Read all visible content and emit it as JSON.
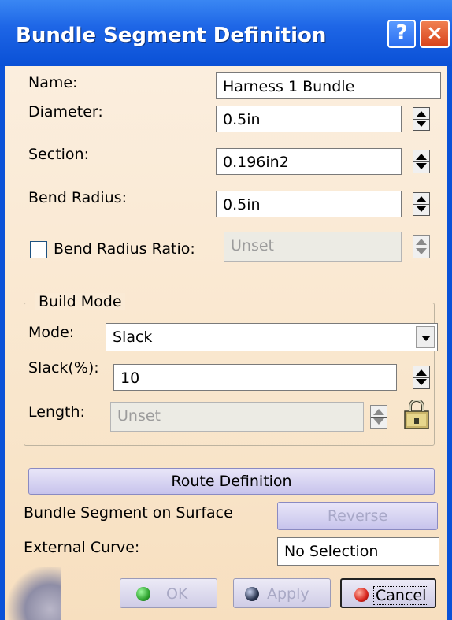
{
  "window": {
    "title": "Bundle Segment Definition",
    "help_label": "?",
    "close_label": "×"
  },
  "fields": {
    "name": {
      "label": "Name:",
      "value": "Harness 1 Bundle"
    },
    "diameter": {
      "label": "Diameter:",
      "value": "0.5in"
    },
    "section": {
      "label": "Section:",
      "value": "0.196in2"
    },
    "bend_radius": {
      "label": "Bend Radius:",
      "value": "0.5in"
    },
    "bend_radius_ratio": {
      "label": "Bend Radius Ratio:",
      "value": "Unset",
      "checked": false
    }
  },
  "build_mode": {
    "legend": "Build Mode",
    "mode": {
      "label": "Mode:",
      "value": "Slack"
    },
    "slack": {
      "label": "Slack(%):",
      "value": "10"
    },
    "length": {
      "label": "Length:",
      "value": "Unset"
    }
  },
  "route_definition_label": "Route Definition",
  "surface": {
    "label": "Bundle Segment on Surface",
    "reverse_label": "Reverse"
  },
  "external_curve": {
    "label": "External Curve:",
    "value": "No Selection"
  },
  "actions": {
    "ok": "OK",
    "apply": "Apply",
    "cancel": "Cancel"
  },
  "colors": {
    "title_bar": "#0a52d8",
    "panel": "#f9e6cc",
    "ok_ball": "#2fa32f",
    "apply_ball": "#2a3550",
    "cancel_ball": "#d8241c"
  },
  "icons": {
    "lock": "padlock-icon"
  }
}
